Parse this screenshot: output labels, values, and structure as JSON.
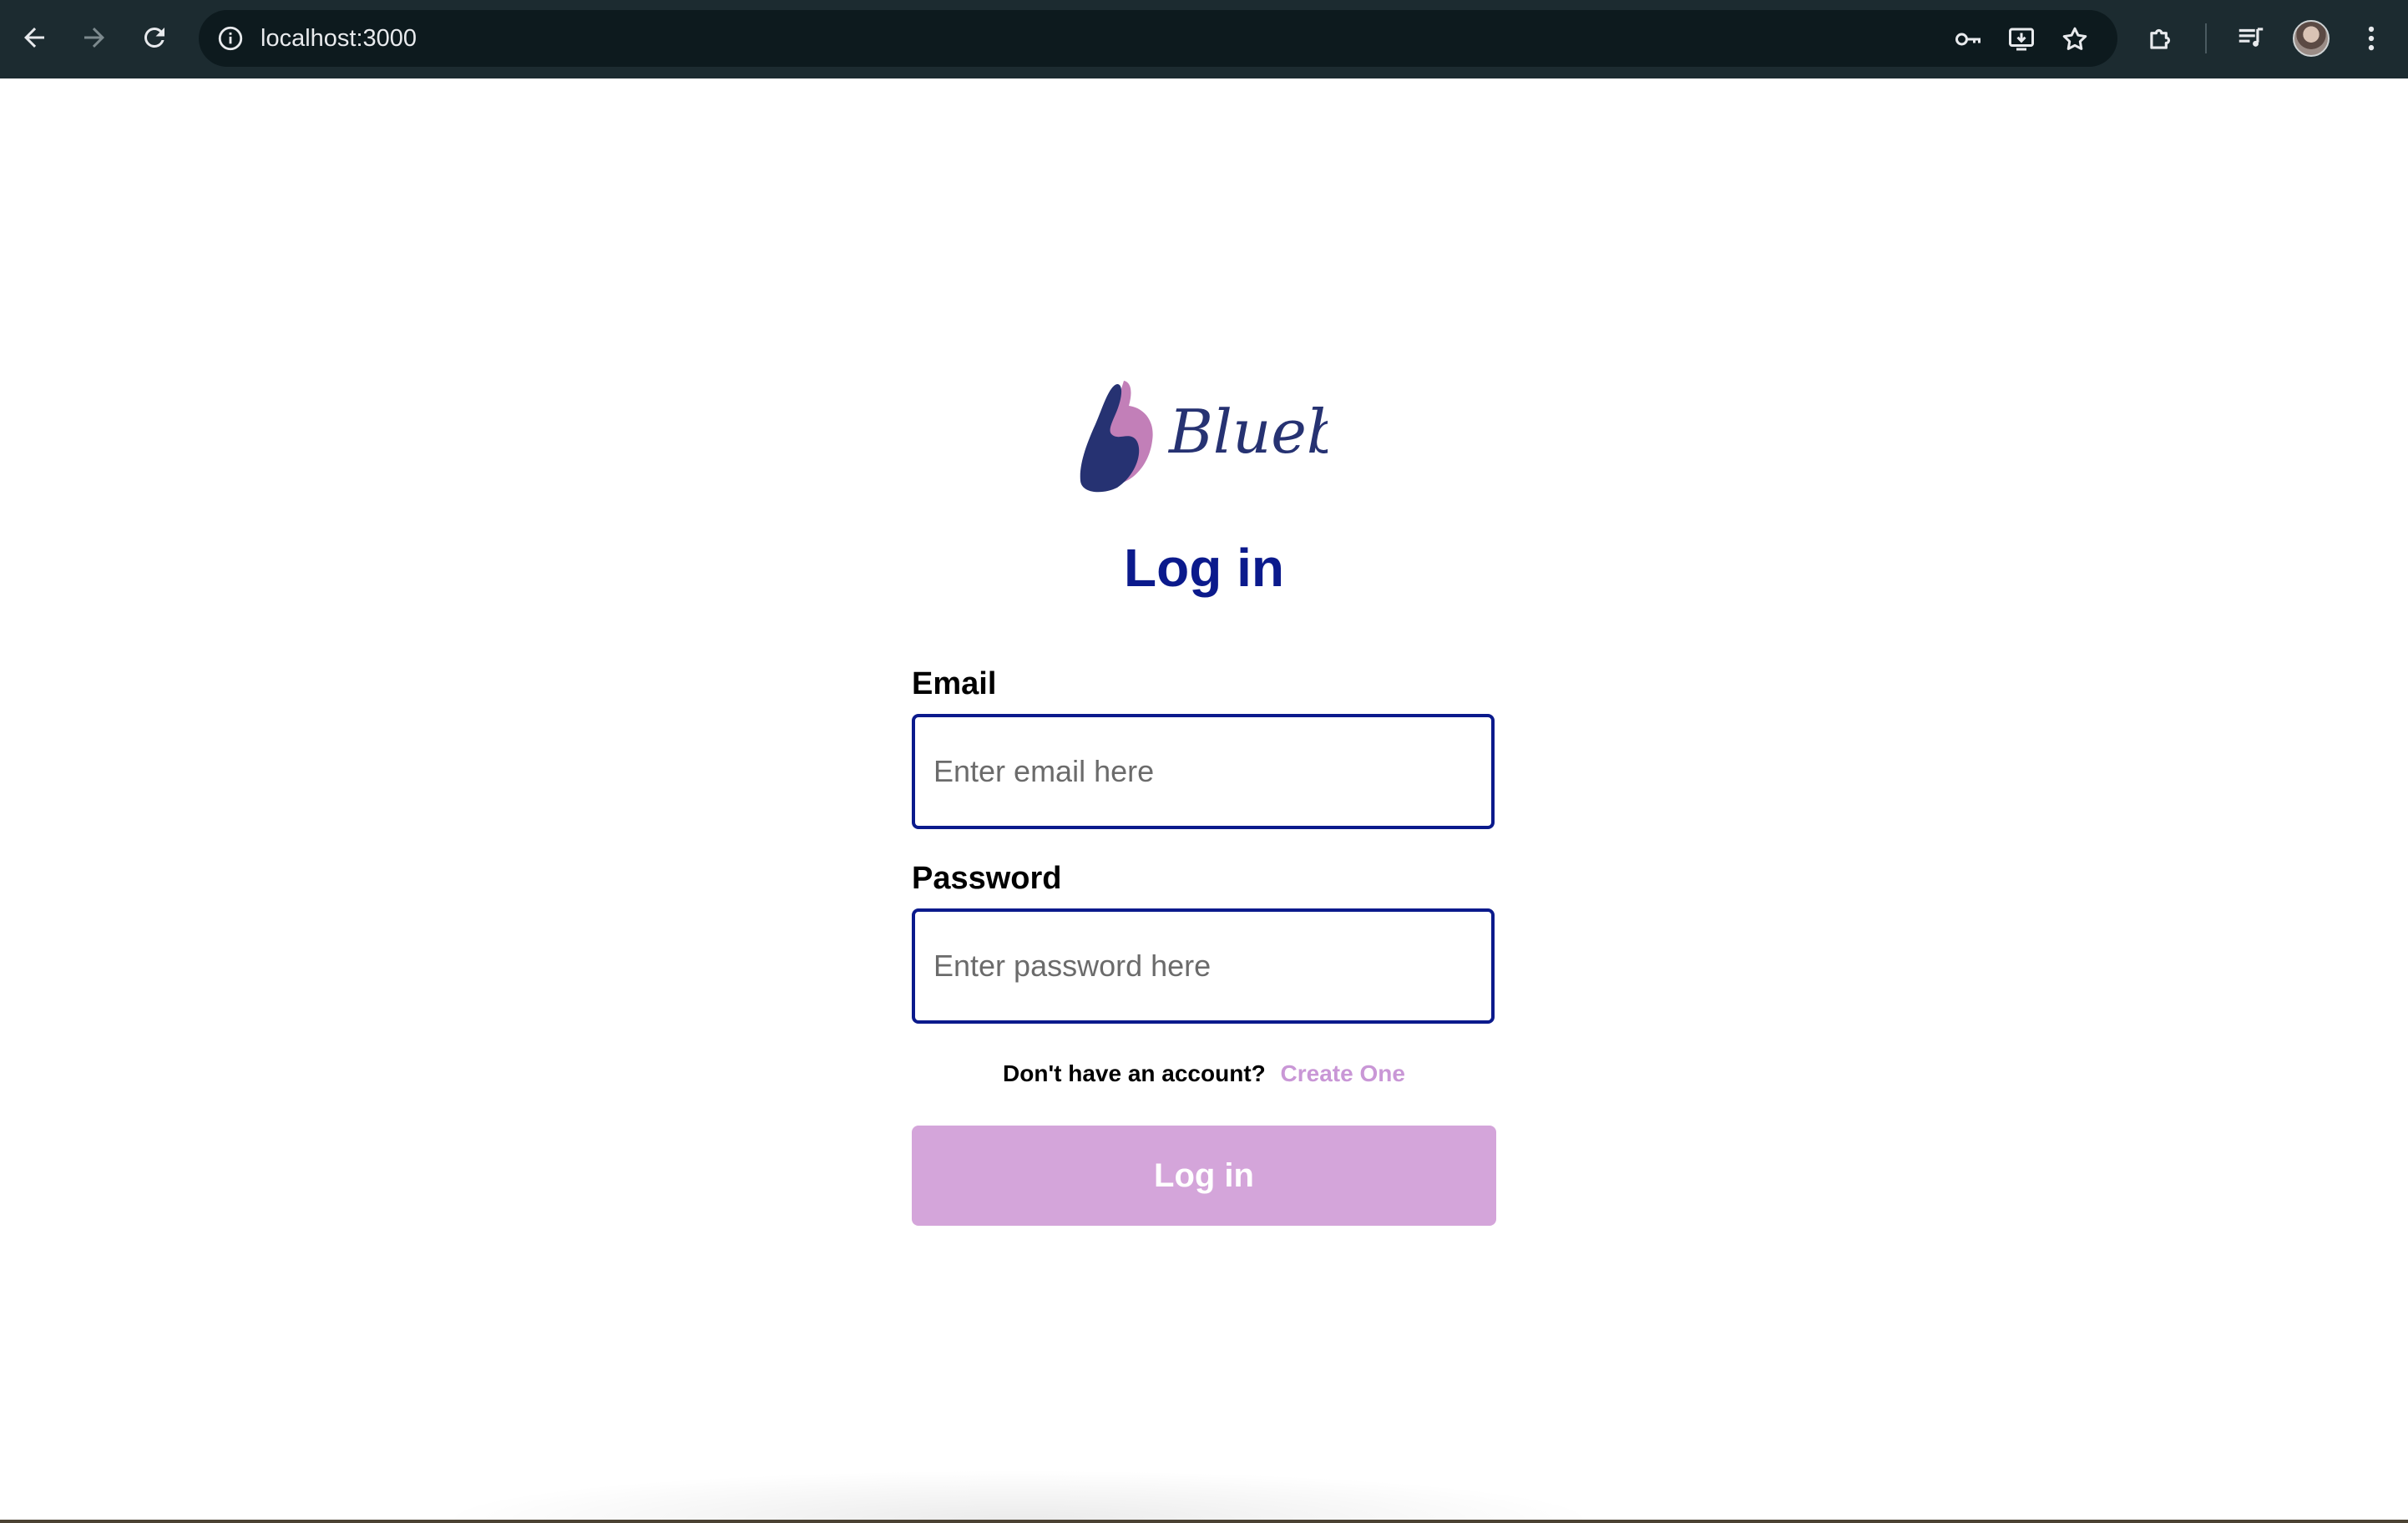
{
  "browser": {
    "url": "localhost:3000",
    "icons": {
      "back": "arrow-left-icon",
      "forward": "arrow-right-icon",
      "reload": "reload-icon",
      "site_info": "info-icon",
      "password": "key-icon",
      "install": "install-app-icon",
      "bookmark": "star-icon",
      "extensions": "puzzle-icon",
      "media": "media-playlist-icon",
      "menu": "kebab-menu-icon"
    },
    "colors": {
      "frame": "#1c2b30",
      "omnibox": "#0d1a1e",
      "text": "#e8eaed"
    }
  },
  "logo": {
    "wordmark": "Blueble",
    "colors": {
      "primary": "#263272",
      "accent": "#c27fb8"
    }
  },
  "page": {
    "title": "Log in"
  },
  "form": {
    "email": {
      "label": "Email",
      "placeholder": "Enter email here",
      "value": ""
    },
    "password": {
      "label": "Password",
      "placeholder": "Enter password here",
      "value": ""
    },
    "signup_prompt": "Don't have an account?",
    "signup_link": "Create One",
    "submit_label": "Log in"
  },
  "theme": {
    "title_color": "#0b1a8c",
    "input_border": "#0b1a8c",
    "button_bg": "#d4a5da",
    "link_color": "#c997d6"
  }
}
